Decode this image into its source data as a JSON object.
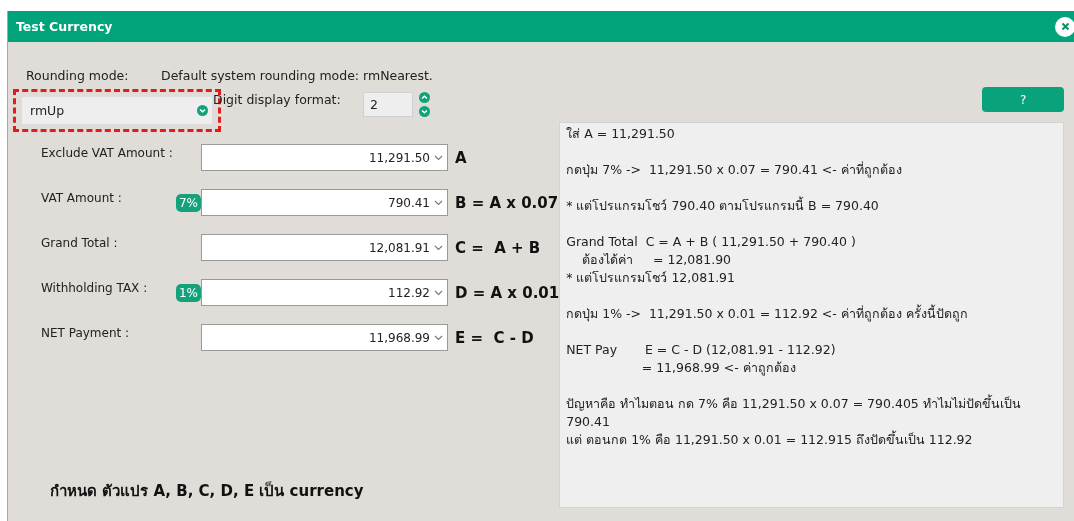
{
  "window": {
    "title": "Test Currency"
  },
  "rounding": {
    "label": "Rounding mode:",
    "default_note": "Default system rounding mode: rmNearest.",
    "value": "rmUp",
    "highlighted": true
  },
  "digits": {
    "label": "Digit display format:",
    "value": "2"
  },
  "fields": [
    {
      "label": "Exclude VAT Amount :",
      "value": "11,291.50",
      "formula": "A"
    },
    {
      "label": "VAT Amount :",
      "badge": "7%",
      "value": "790.41",
      "formula": "B = A x 0.07"
    },
    {
      "label": "Grand Total :",
      "value": "12,081.91",
      "formula": "C =  A + B"
    },
    {
      "label": "Withholding TAX :",
      "badge": "1%",
      "value": "112.92",
      "formula": "D = A x 0.01"
    },
    {
      "label": "NET Payment :",
      "value": "11,968.99",
      "formula": "E =  C - D"
    }
  ],
  "help_button": "?",
  "notes": [
    [
      "ใส่ A = 11,291.50"
    ],
    [
      "กดปุ่ม 7% ->  11,291.50 x 0.07 = 790.41 <- ค่าที่ถูกต้อง"
    ],
    [
      "* แต่โปรแกรมโชว์ 790.40 ตามโปรแกรมนี้ B = 790.40"
    ],
    [
      "Grand Total  C = A + B ( 11,291.50 + 790.40 )",
      "    ต้องได้ค่า     = 12,081.90",
      "* แต่โปรแกรมโชว์ 12,081.91"
    ],
    [
      "กดปุ่ม 1% ->  11,291.50 x 0.01 = 112.92 <- ค่าที่ถูกต้อง ครั้งนี้ปัดถูก"
    ],
    [
      "NET Pay       E = C - D (12,081.91 - 112.92)",
      "                   = 11,968.99 <- ค่าถูกต้อง"
    ],
    [
      "ปัญหาคือ ทำไมตอน กด 7% คือ 11,291.50 x 0.07 = 790.405 ทำไมไม่ปัดขึ้นเป็น 790.41",
      "แต่ ตอนกด 1% คือ 11,291.50 x 0.01 = 112.915 ถึงปัดขึ้นเป็น 112.92"
    ]
  ],
  "footer": "กำหนด ตัวแปร A, B, C, D, E เป็น currency"
}
